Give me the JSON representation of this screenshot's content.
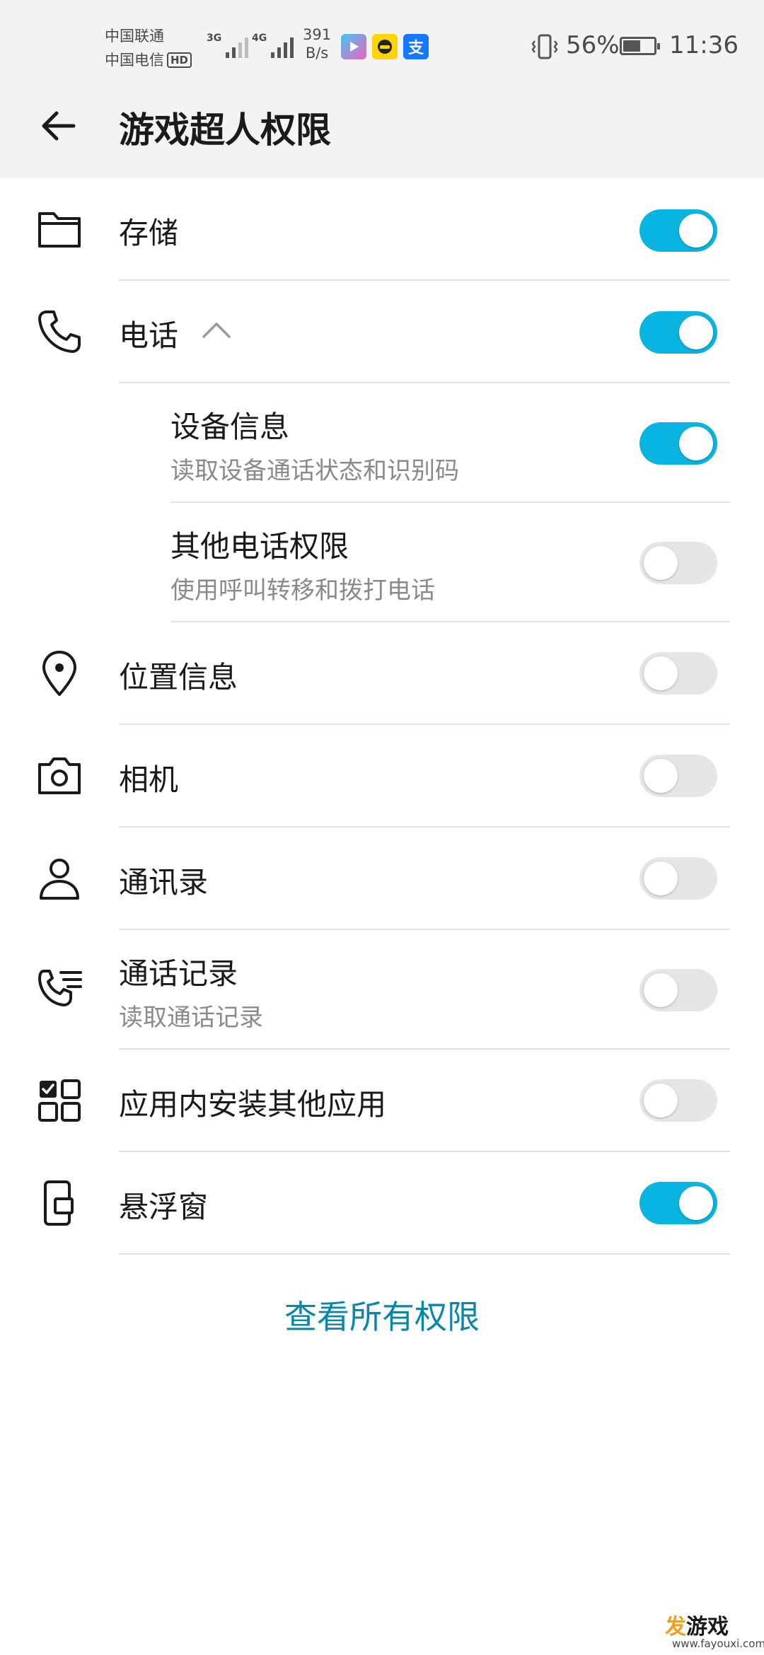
{
  "status_bar": {
    "carrier1": "中国联通",
    "carrier2": "中国电信",
    "hd": "HD",
    "net_3g": "3G",
    "net_4g": "4G",
    "speed_value": "391",
    "speed_unit": "B/s",
    "app_icon_alipay": "支",
    "battery_percent": "56%",
    "battery_level": 0.56,
    "time": "11:36"
  },
  "header": {
    "title": "游戏超人权限"
  },
  "permissions": [
    {
      "title": "存储",
      "subtitle": "",
      "enabled": true,
      "icon": "folder-icon"
    },
    {
      "title": "电话",
      "subtitle": "",
      "enabled": true,
      "icon": "phone-icon",
      "expanded": true
    },
    {
      "title": "设备信息",
      "subtitle": "读取设备通话状态和识别码",
      "enabled": true,
      "nested": true
    },
    {
      "title": "其他电话权限",
      "subtitle": "使用呼叫转移和拨打电话",
      "enabled": false,
      "nested": true
    },
    {
      "title": "位置信息",
      "subtitle": "",
      "enabled": false,
      "icon": "location-pin-icon"
    },
    {
      "title": "相机",
      "subtitle": "",
      "enabled": false,
      "icon": "camera-icon"
    },
    {
      "title": "通讯录",
      "subtitle": "",
      "enabled": false,
      "icon": "person-icon"
    },
    {
      "title": "通话记录",
      "subtitle": "读取通话记录",
      "enabled": false,
      "icon": "call-log-icon"
    },
    {
      "title": "应用内安装其他应用",
      "subtitle": "",
      "enabled": false,
      "icon": "install-apps-icon"
    },
    {
      "title": "悬浮窗",
      "subtitle": "",
      "enabled": true,
      "icon": "floating-window-icon"
    }
  ],
  "footer": {
    "view_all": "查看所有权限"
  },
  "watermark": {
    "brand_accent": "发",
    "brand_rest": "游戏",
    "url": "www.fayouxi.com"
  },
  "colors": {
    "toggle_on": "#0ab4e0",
    "toggle_off": "#e6e6e6",
    "link": "#0a87a8"
  }
}
